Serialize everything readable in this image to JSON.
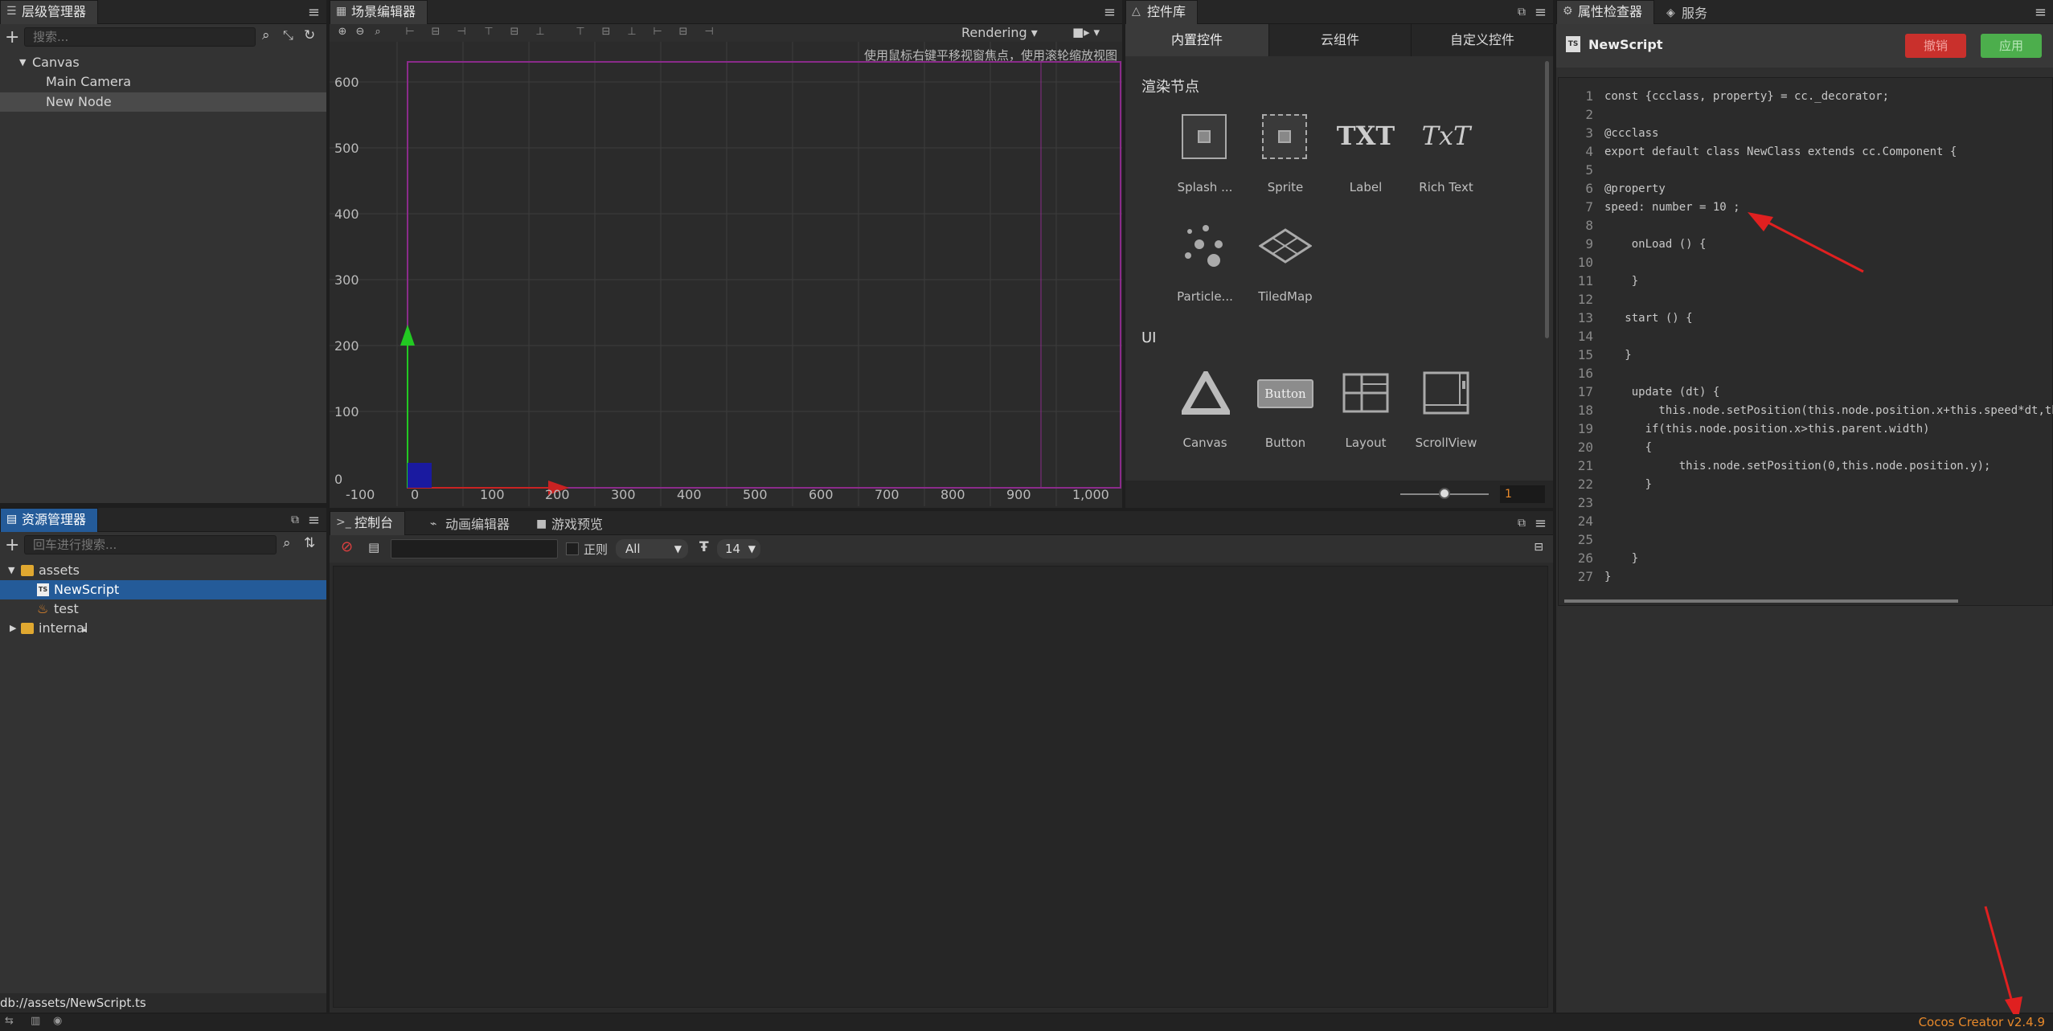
{
  "hierarchy": {
    "tab_label": "层级管理器",
    "search_placeholder": "搜索...",
    "nodes": [
      "Canvas",
      "Main Camera",
      "New Node"
    ]
  },
  "scene": {
    "tab_label": "场景编辑器",
    "render_mode": "Rendering",
    "hint": "使用鼠标右键平移视窗焦点，使用滚轮缩放视图",
    "y_ticks": [
      "600",
      "500",
      "400",
      "300",
      "200",
      "100",
      "0"
    ],
    "x_ticks": [
      "-100",
      "0",
      "100",
      "200",
      "300",
      "400",
      "500",
      "600",
      "700",
      "800",
      "900",
      "1,000"
    ]
  },
  "widgets": {
    "tab_label": "控件库",
    "subtabs": [
      "内置控件",
      "云组件",
      "自定义控件"
    ],
    "section_render": "渲染节点",
    "render_items": [
      "Splash ...",
      "Sprite",
      "Label",
      "Rich Text",
      "Particle...",
      "TiledMap"
    ],
    "label_icon_text": "TXT",
    "richtext_icon_text": "TxT",
    "section_ui": "UI",
    "ui_items": [
      "Canvas",
      "Button",
      "Layout",
      "ScrollView"
    ],
    "button_icon_text": "Button",
    "zoom_value": "1"
  },
  "inspector": {
    "tab_label": "属性检查器",
    "tab_service": "服务",
    "file_name": "NewScript",
    "revert_label": "撤销",
    "apply_label": "应用",
    "code_lines": [
      "const {ccclass, property} = cc._decorator;",
      "",
      "@ccclass",
      "export default class NewClass extends cc.Component {",
      "",
      "@property",
      "speed: number = 10 ;",
      "",
      "    onLoad () {",
      "",
      "    }",
      "",
      "   start () {",
      "",
      "   }",
      "",
      "    update (dt) {",
      "        this.node.setPosition(this.node.position.x+this.speed*dt,this",
      "      if(this.node.position.x>this.parent.width)",
      "      {",
      "           this.node.setPosition(0,this.node.position.y);",
      "      }",
      "",
      "",
      "",
      "    }",
      "}"
    ]
  },
  "assets": {
    "tab_label": "资源管理器",
    "search_placeholder": "回车进行搜索...",
    "items": [
      "assets",
      "NewScript",
      "test",
      "internal"
    ]
  },
  "console": {
    "tabs": [
      "控制台",
      "动画编辑器",
      "游戏预览"
    ],
    "regex_label": "正则",
    "level_value": "All",
    "font_size_value": "14"
  },
  "status": {
    "path": "db://assets/NewScript.ts",
    "version": "Cocos Creator v2.4.9"
  },
  "colors": {
    "accent_blue": "#245b99",
    "revert_red": "#c9302c",
    "apply_green": "#4cae4c",
    "version_orange": "#e8892a",
    "annotation_red": "#e02020"
  }
}
